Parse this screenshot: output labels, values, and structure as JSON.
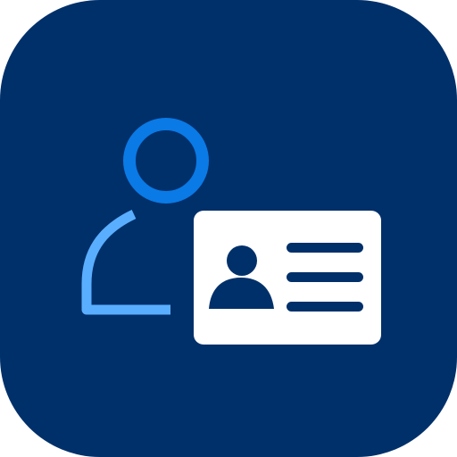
{
  "app_icon": {
    "icon_name": "user-id-card-icon",
    "colors": {
      "background": "#00306A",
      "person_head": "#0A7AE6",
      "person_body": "#5AAEFF",
      "card_fill": "#FFFFFF",
      "card_details": "#00306A"
    }
  }
}
